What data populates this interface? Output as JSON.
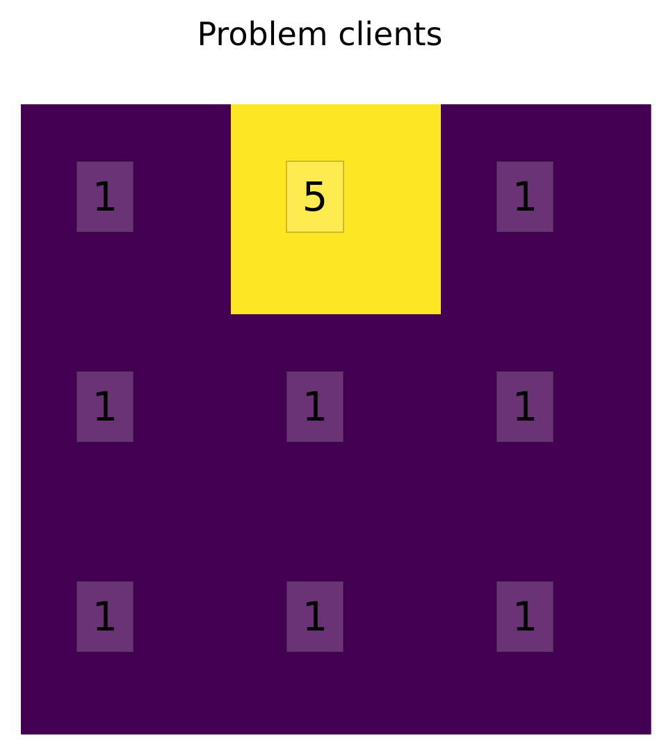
{
  "chart_data": {
    "type": "heatmap",
    "title": "Problem clients",
    "rows": 3,
    "cols": 3,
    "values": [
      [
        1,
        5,
        1
      ],
      [
        1,
        1,
        1
      ],
      [
        1,
        1,
        1
      ]
    ],
    "colormap": "viridis",
    "low_color": "#440154",
    "high_color": "#fde725",
    "value_range": [
      1,
      5
    ],
    "grid": false,
    "axes_visible": false,
    "annotations": "cell values shown in each cell"
  }
}
